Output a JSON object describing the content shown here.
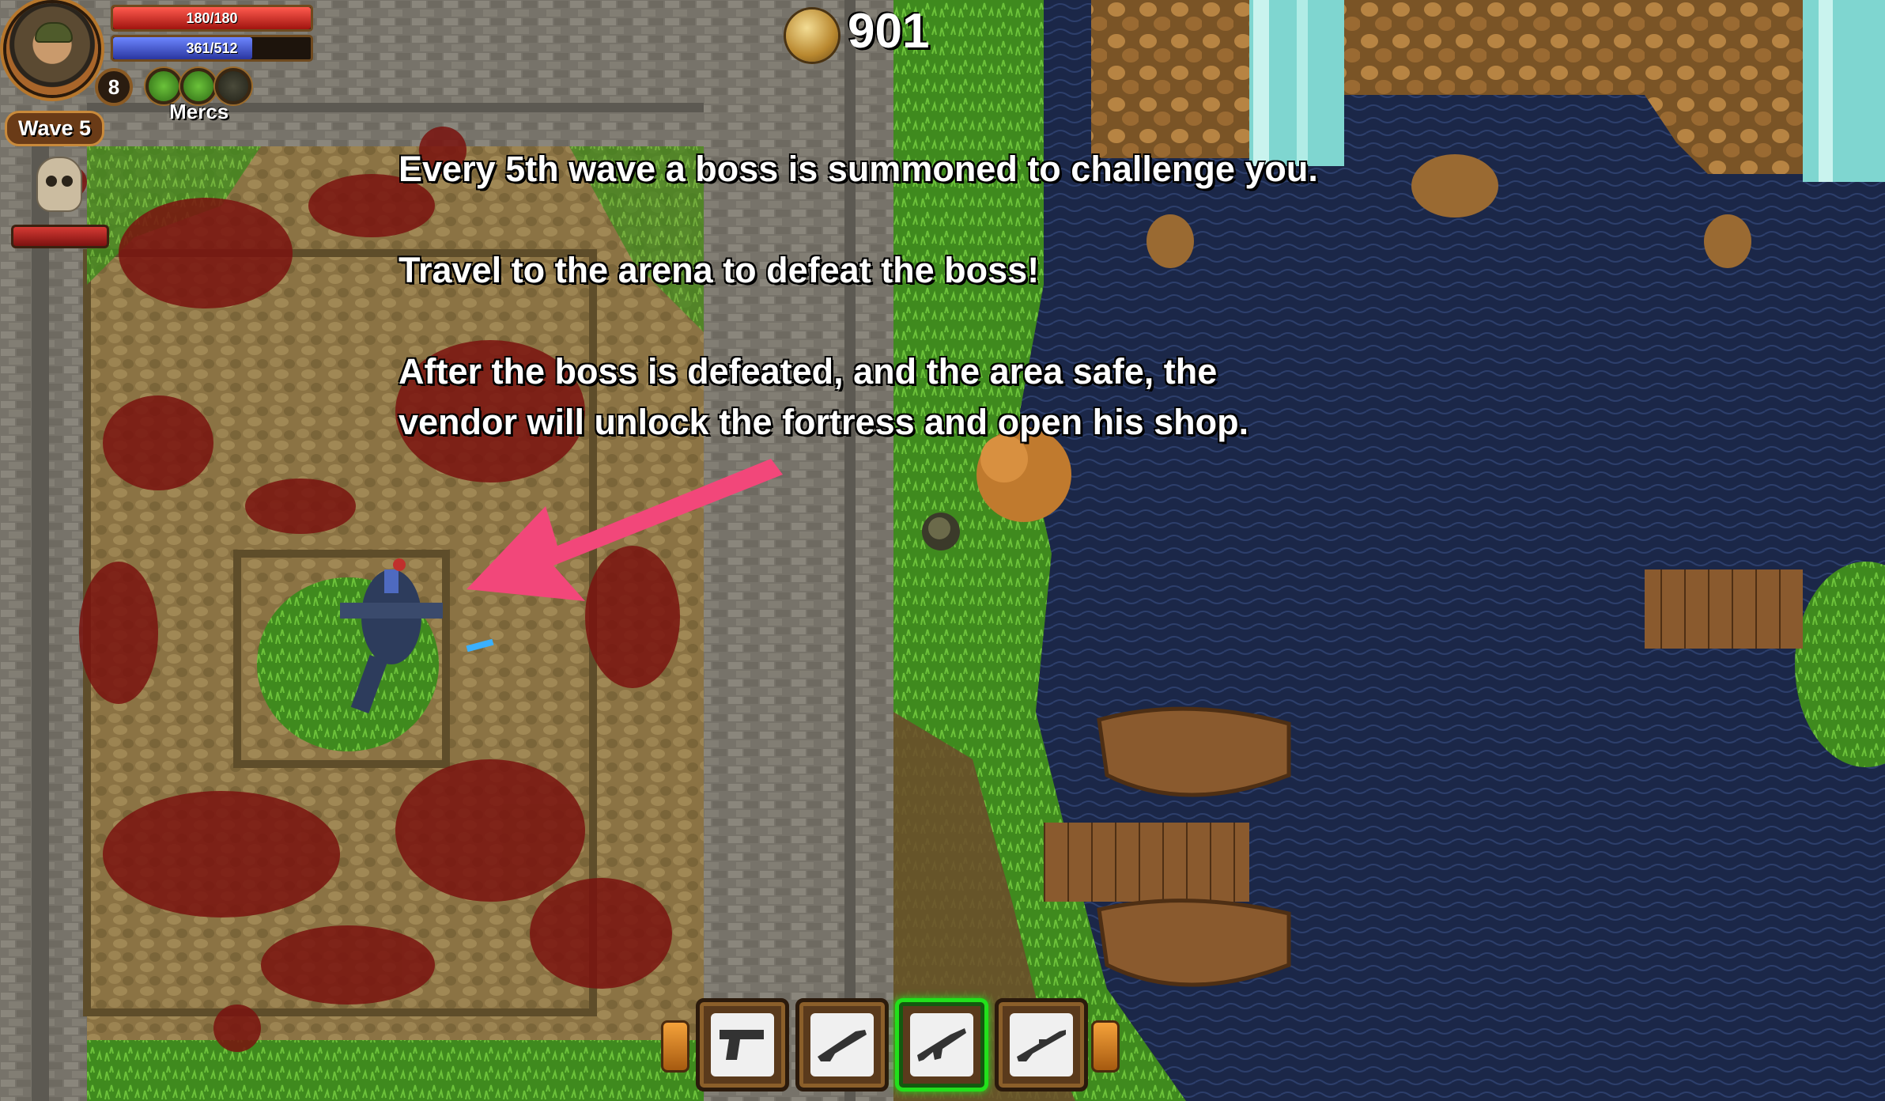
{
  "hud": {
    "health_text": "180/180",
    "health_fraction": 1.0,
    "energy_text": "361/512",
    "energy_fraction": 0.705,
    "player_level": "8",
    "mercs_label": "Mercs",
    "wave_label": "Wave 5",
    "coins": "901",
    "boss_health_fraction": 1.0
  },
  "tutorial": {
    "line1": "Every 5th wave a boss is summoned to challenge you.",
    "line2": "Travel to the arena to defeat the boss!",
    "line3a": "After the boss is defeated, and the area safe, the",
    "line3b": "vendor will unlock the fortress and open his shop."
  },
  "weapons": {
    "slots": [
      "pistol-icon",
      "shotgun-icon",
      "assault-rifle-icon",
      "sniper-rifle-icon"
    ],
    "active_index": 2
  },
  "colors": {
    "health": "#c8201c",
    "energy": "#3b4fc8",
    "arrow": "#f2477a",
    "active_slot": "#22e01b",
    "water": "#1b2748",
    "grass": "#3f8a1e"
  }
}
